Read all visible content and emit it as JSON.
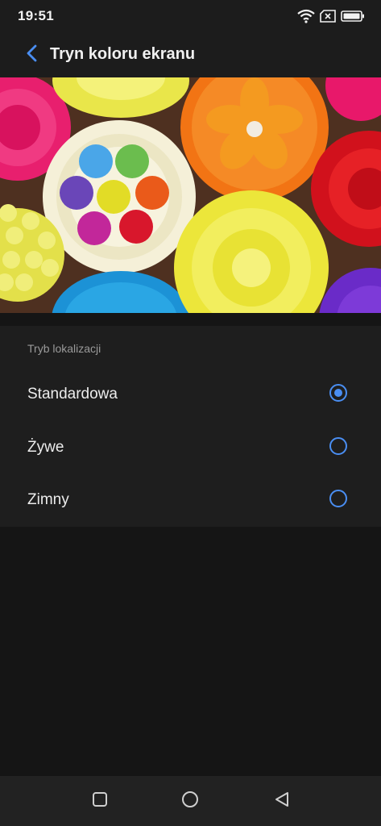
{
  "status_bar": {
    "time": "19:51",
    "icons": [
      "wifi-icon",
      "sim-absent-icon",
      "battery-icon"
    ]
  },
  "header": {
    "back_icon": "chevron-left-icon",
    "title": "Tryn koloru ekranu"
  },
  "preview": {
    "image": "colorful cupcakes sample image"
  },
  "options": {
    "section_label": "Tryb lokalizacji",
    "items": [
      {
        "label": "Standardowa",
        "selected": true
      },
      {
        "label": "Żywe",
        "selected": false
      },
      {
        "label": "Zimny",
        "selected": false
      }
    ]
  },
  "nav_bar": {
    "buttons": [
      "recents-square-icon",
      "home-circle-icon",
      "back-triangle-icon"
    ]
  },
  "colors": {
    "accent": "#4a8ef2",
    "background": "#151515",
    "card": "#1e1e1e",
    "header": "#1c1c1c"
  }
}
